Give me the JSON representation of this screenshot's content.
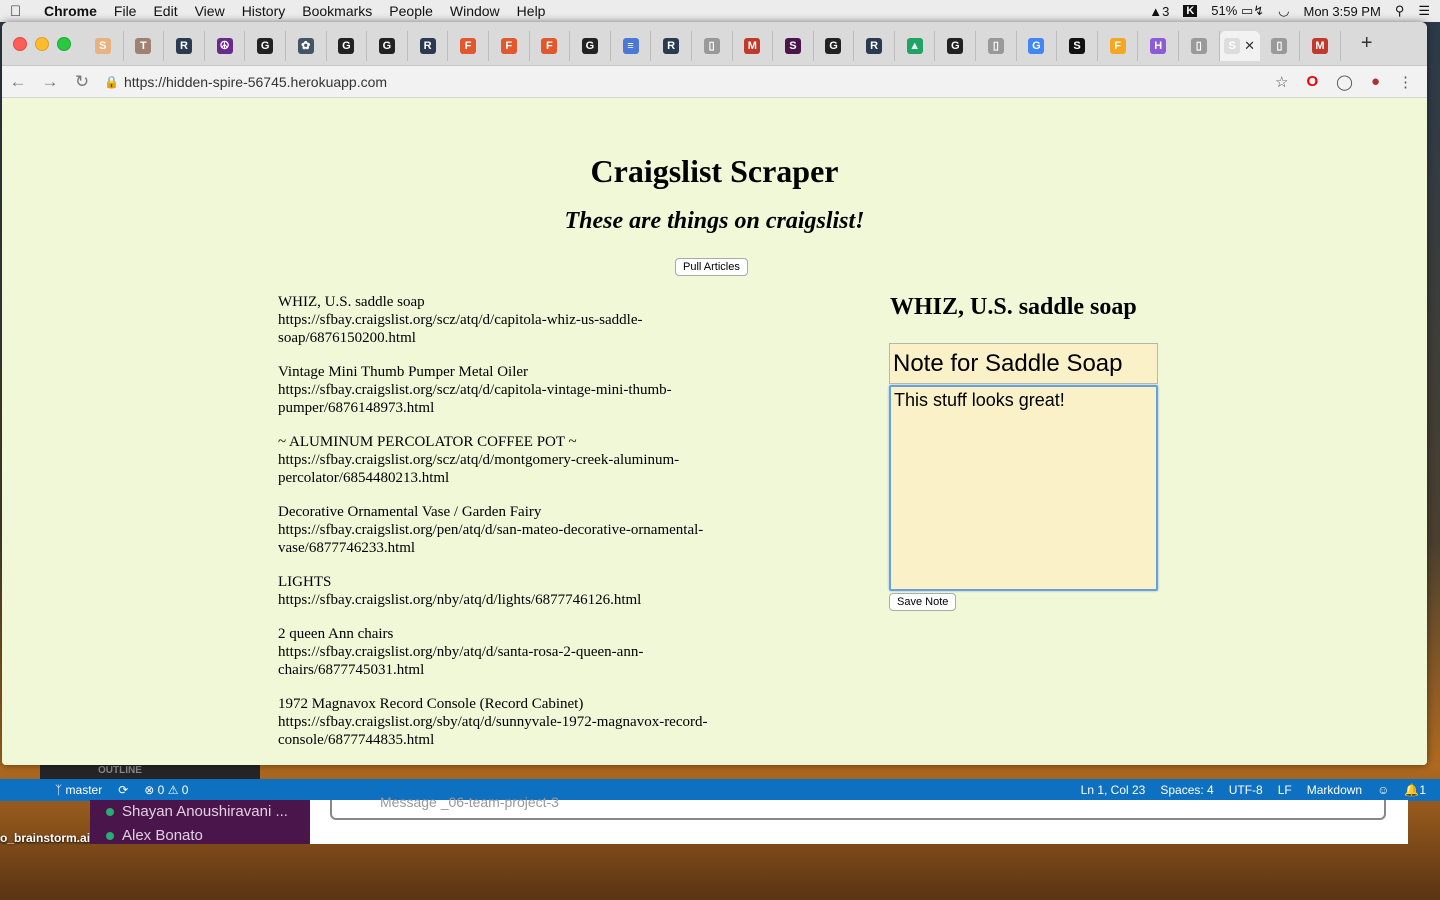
{
  "menubar": {
    "app": "Chrome",
    "items": [
      "File",
      "Edit",
      "View",
      "History",
      "Bookmarks",
      "People",
      "Window",
      "Help"
    ],
    "status": {
      "adobe_count": "3",
      "battery": "51%",
      "clock": "Mon 3:59 PM"
    }
  },
  "browser": {
    "tab_favicons": [
      "S",
      "T",
      "R",
      "☮",
      "G",
      "✿",
      "G",
      "G",
      "R",
      "F",
      "F",
      "F",
      "G",
      "≡",
      "R",
      "▯",
      "M",
      "S",
      "G",
      "R",
      "▲",
      "G",
      "▯",
      "G",
      "S",
      "F",
      "H",
      "▯",
      "S",
      "▯",
      "M"
    ],
    "active_tab_index": 28,
    "url": "https://hidden-spire-56745.herokuapp.com"
  },
  "page": {
    "title": "Craigslist Scraper",
    "subtitle": "These are things on craigslist!",
    "pull_button": "Pull Articles",
    "articles": [
      {
        "title": "WHIZ, U.S. saddle soap",
        "link": "https://sfbay.craigslist.org/scz/atq/d/capitola-whiz-us-saddle-soap/6876150200.html"
      },
      {
        "title": "Vintage Mini Thumb Pumper Metal Oiler",
        "link": "https://sfbay.craigslist.org/scz/atq/d/capitola-vintage-mini-thumb-pumper/6876148973.html"
      },
      {
        "title": "~ ALUMINUM PERCOLATOR COFFEE POT ~",
        "link": "https://sfbay.craigslist.org/scz/atq/d/montgomery-creek-aluminum-percolator/6854480213.html"
      },
      {
        "title": "Decorative Ornamental Vase / Garden Fairy",
        "link": "https://sfbay.craigslist.org/pen/atq/d/san-mateo-decorative-ornamental-vase/6877746233.html"
      },
      {
        "title": "LIGHTS",
        "link": "https://sfbay.craigslist.org/nby/atq/d/lights/6877746126.html"
      },
      {
        "title": "2 queen Ann chairs",
        "link": "https://sfbay.craigslist.org/nby/atq/d/santa-rosa-2-queen-ann-chairs/6877745031.html"
      },
      {
        "title": "1972 Magnavox Record Console (Record Cabinet)",
        "link": "https://sfbay.craigslist.org/sby/atq/d/sunnyvale-1972-magnavox-record-console/6877744835.html"
      }
    ],
    "note": {
      "heading": "WHIZ, U.S. saddle soap",
      "title_value": "Note for Saddle Soap",
      "body_value": "This stuff looks great!",
      "save_button": "Save Note"
    }
  },
  "background": {
    "vscode_outline": "OUTLINE",
    "vscode_status_left": [
      "master",
      "⟳",
      "⊗ 0 ⚠ 0"
    ],
    "vscode_status_right": [
      "Ln 1, Col 23",
      "Spaces: 4",
      "UTF-8",
      "LF",
      "Markdown",
      "☺",
      "🔔1"
    ],
    "slack_users": [
      "Shayan Anoushiravani ...",
      "Alex Bonato"
    ],
    "slack_message_placeholder": "Message _06-team-project-3",
    "desktop_label": "o_brainstorm.ai"
  },
  "colors": {
    "page_background": "#f1f8d8",
    "note_field_background": "#faf1c8",
    "vscode_status": "#0e70c0",
    "slack_sidebar": "#4a154b"
  }
}
